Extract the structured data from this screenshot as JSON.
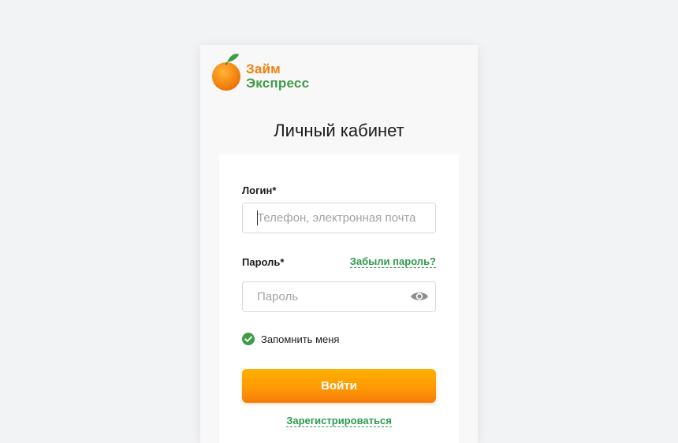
{
  "logo": {
    "line1": "Займ",
    "line2": "Экспресс"
  },
  "page": {
    "title": "Личный кабинет"
  },
  "form": {
    "login_label": "Логин*",
    "login_placeholder": "Телефон, электронная почта",
    "password_label": "Пароль*",
    "forgot_link": "Забыли пароль?",
    "password_placeholder": "Пароль",
    "remember_label": "Запомнить меня",
    "remember_checked": true,
    "submit_label": "Войти",
    "register_link": "Зарегистрироваться"
  },
  "icons": {
    "logo": "orange-fruit-icon",
    "password_toggle": "eye-icon",
    "remember": "check-circle-icon"
  },
  "colors": {
    "accent_orange": "#ff9a05",
    "brand_green": "#2e9a4f",
    "background": "#f2f3f5"
  }
}
